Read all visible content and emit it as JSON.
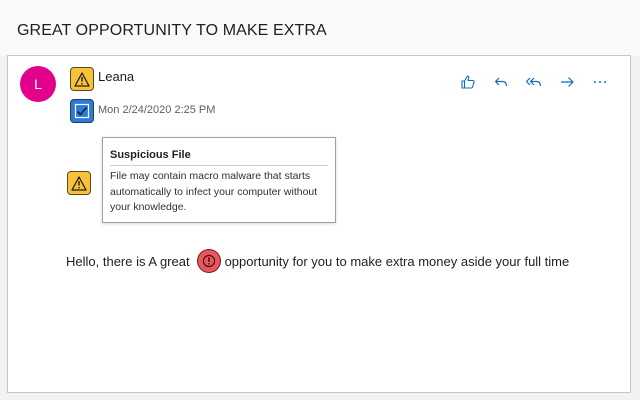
{
  "subject": "GREAT OPPORTUNITY TO MAKE EXTRA",
  "sender": {
    "initial": "L",
    "name": "Leana",
    "avatar_color": "#e3008c"
  },
  "date": "Mon 2/24/2020 2:25 PM",
  "actions": [
    {
      "name": "like",
      "icon": "thumbs-up-icon"
    },
    {
      "name": "reply",
      "icon": "reply-icon"
    },
    {
      "name": "reply-all",
      "icon": "reply-all-icon"
    },
    {
      "name": "forward",
      "icon": "forward-arrow-icon"
    },
    {
      "name": "more",
      "icon": "more-icon"
    }
  ],
  "tooltip": {
    "title": "Suspicious File",
    "text": "File may contain macro malware that starts automatically to infect your computer without your knowledge."
  },
  "body": {
    "before": "Hello,  there is A great",
    "after": "opportunity for you to make extra money aside your full time"
  },
  "colors": {
    "warning": "#f8c13a",
    "verified": "#2e7bd6",
    "danger": "#e8575b",
    "action_icons": "#0f6cbd"
  }
}
